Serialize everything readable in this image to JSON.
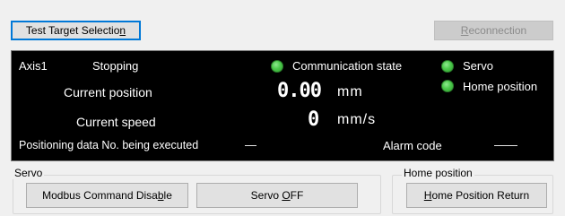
{
  "toolbar": {
    "test_target_label": "Test Target Selection",
    "test_target_mnemonic": "n",
    "reconnection_label": "Reconnection",
    "reconnection_mnemonic": "R"
  },
  "status": {
    "axis": "Axis1",
    "state": "Stopping",
    "communication_state": "Communication state",
    "servo": "Servo",
    "home_position": "Home position",
    "current_position_label": "Current position",
    "current_position_value": "0.00",
    "current_position_unit": "mm",
    "current_speed_label": "Current speed",
    "current_speed_value": "0",
    "current_speed_unit": "mm/s",
    "positioning_data_label": "Positioning data No. being executed",
    "positioning_data_value": "—",
    "alarm_code_label": "Alarm code",
    "alarm_code_value": "——",
    "indicator_color": "#4cc94c"
  },
  "servo_group": {
    "title": "Servo",
    "modbus_disable_label": "Modbus Command Disable",
    "servo_off_label": "Servo OFF"
  },
  "home_group": {
    "title": "Home position",
    "home_return_label": "Home Position Return"
  }
}
